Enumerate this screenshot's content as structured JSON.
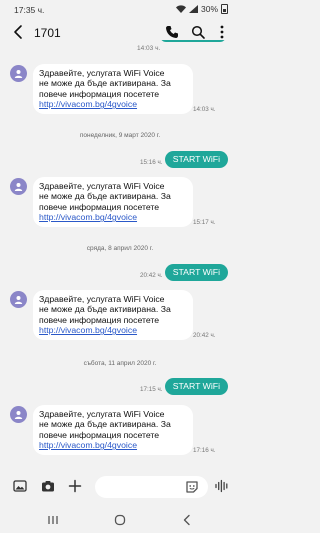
{
  "status_bar": {
    "time": "17:35 ч.",
    "battery": "30%"
  },
  "header": {
    "contact": "1701"
  },
  "top_partial": {
    "time": "14:03 ч."
  },
  "incoming_lines": [
    "Здравейте, услугата WiFi Voice",
    "не може да бъде активирана. За",
    "повече информация посетете"
  ],
  "incoming_link": "http://vivacom.bg/4gvoice",
  "conversation": {
    "in1": {
      "time": "14:03 ч."
    },
    "sep1": "понеделник, 9 март 2020 г.",
    "out1": {
      "text": "START WiFi",
      "time": "15:16 ч."
    },
    "in2": {
      "time": "15:17 ч."
    },
    "sep2": "сряда, 8 април 2020 г.",
    "out2": {
      "text": "START WiFi",
      "time": "20:42 ч."
    },
    "in3": {
      "time": "20:42 ч."
    },
    "sep3": "събота, 11 април 2020 г.",
    "out3": {
      "text": "START WiFi",
      "time": "17:15 ч."
    },
    "in4": {
      "time": "17:16 ч."
    }
  },
  "composer": {
    "placeholder": ""
  },
  "colors": {
    "accent": "#1fa79a",
    "avatar": "#8b86c8",
    "link": "#2a58c8",
    "background": "#f2f2f2"
  },
  "icons": {
    "header": [
      "back-arrow-icon",
      "phone-icon",
      "search-icon",
      "more-vert-icon"
    ],
    "composer": [
      "gallery-icon",
      "camera-icon",
      "add-icon",
      "sticker-icon",
      "voice-icon"
    ],
    "navigation": [
      "recent-apps-icon",
      "home-icon",
      "back-icon"
    ]
  }
}
